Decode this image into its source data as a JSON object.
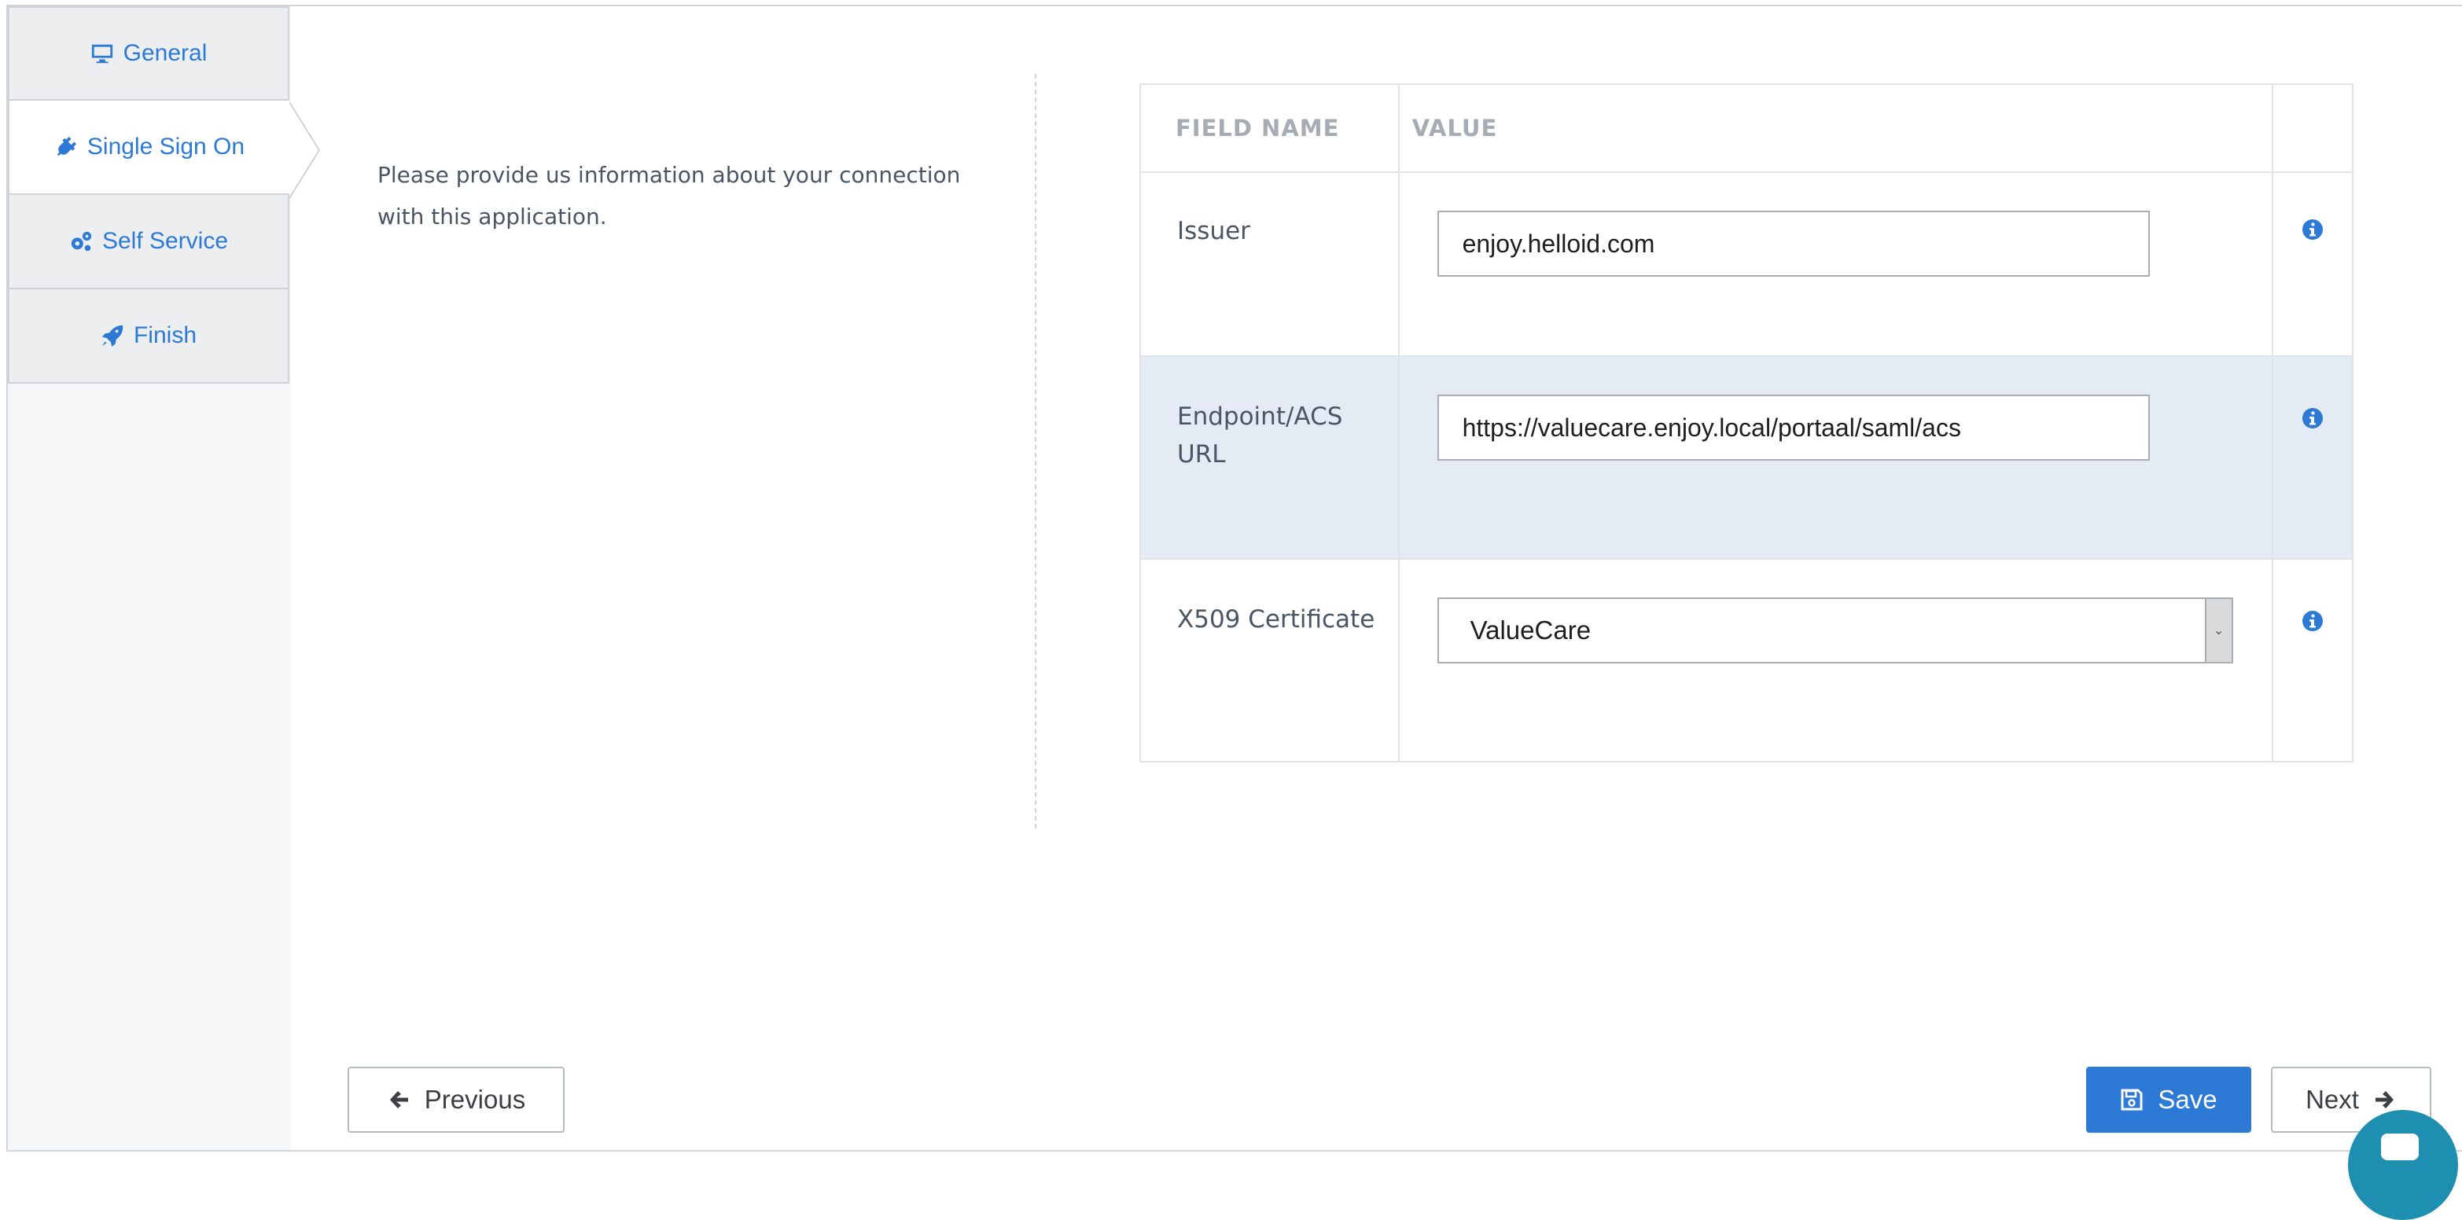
{
  "sidebar": {
    "tabs": [
      {
        "label": "General",
        "icon": "monitor-icon"
      },
      {
        "label": "Single Sign On",
        "icon": "plug-icon",
        "active": true
      },
      {
        "label": "Self Service",
        "icon": "gears-icon"
      },
      {
        "label": "Finish",
        "icon": "rocket-icon"
      }
    ]
  },
  "intro": {
    "text": "Please provide us information about your connection with this application."
  },
  "table": {
    "headers": {
      "field_name": "FIELD NAME",
      "value": "VALUE"
    },
    "rows": [
      {
        "label": "Issuer",
        "value": "enjoy.helloid.com",
        "type": "text"
      },
      {
        "label": "Endpoint/ACS URL",
        "value": "https://valuecare.enjoy.local/portaal/saml/acs",
        "type": "text"
      },
      {
        "label": "X509 Certificate",
        "value": "ValueCare",
        "type": "select"
      }
    ]
  },
  "buttons": {
    "previous": "Previous",
    "save": "Save",
    "next": "Next"
  },
  "colors": {
    "accent": "#2d7ad6",
    "highlight_row": "#e4ebf4",
    "chat": "#1e8fb0"
  }
}
